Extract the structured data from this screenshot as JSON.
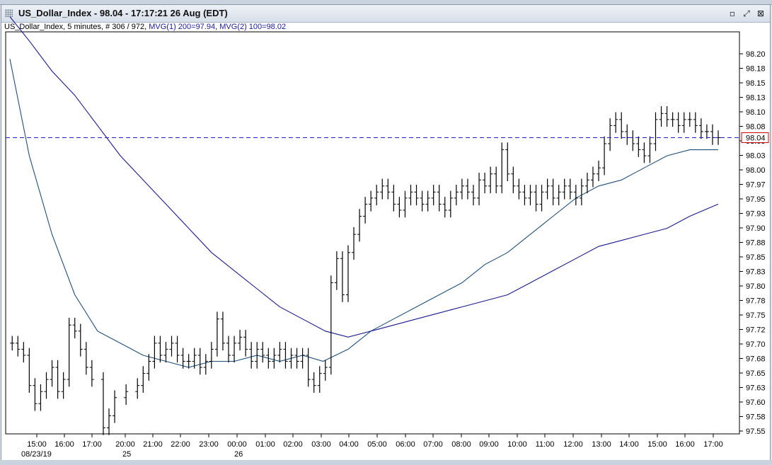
{
  "window": {
    "title": "US_Dollar_Index - 98.04 - 17:17:21  26 Aug (EDT)",
    "buttons": [
      "minimize-icon",
      "restore-icon",
      "close-icon"
    ]
  },
  "info": {
    "symbol": "US_Dollar_Index",
    "details": ", 5 minutes, # 306 / 972, ",
    "mvg1": "MVG(1) 200=97.94",
    "mvg2": "MVG(2) 100=98.02"
  },
  "colors": {
    "price": "#000000",
    "mvg1": "#1a1a8c",
    "mvg2": "#1f4f7a",
    "last_line": "#2222cc",
    "last_box": "#d40000"
  },
  "chart_data": {
    "type": "line",
    "title": "US_Dollar_Index",
    "interval": "5 minutes",
    "y_tick_labels": [
      "98.20",
      "98.18",
      "98.15",
      "98.13",
      "98.10",
      "98.08",
      "98.05",
      "98.03",
      "98.00",
      "97.97",
      "97.95",
      "97.93",
      "97.90",
      "97.88",
      "97.85",
      "97.83",
      "97.80",
      "97.78",
      "97.75",
      "97.72",
      "97.70",
      "97.68",
      "97.65",
      "97.63",
      "97.60",
      "97.58",
      "97.55"
    ],
    "ylim": [
      97.55,
      98.215
    ],
    "x_tick_labels": [
      "15:00",
      "16:00",
      "17:00",
      "20:00",
      "21:00",
      "22:00",
      "23:00",
      "00:00",
      "01:00",
      "02:00",
      "03:00",
      "04:00",
      "05:00",
      "06:00",
      "07:00",
      "08:00",
      "09:00",
      "10:00",
      "11:00",
      "12:00",
      "13:00",
      "14:00",
      "15:00",
      "16:00",
      "17:00"
    ],
    "date_labels": [
      {
        "text": "08/23/19",
        "at_tick": "15:00"
      },
      {
        "text": "25",
        "at_tick": "20:00"
      },
      {
        "text": "26",
        "at_tick": "00:00"
      }
    ],
    "last_value": 98.04,
    "last_value_label": "98.04",
    "price_path": [
      [
        14.25,
        97.7
      ],
      [
        14.5,
        97.69
      ],
      [
        14.75,
        97.68
      ],
      [
        15.0,
        97.63
      ],
      [
        15.25,
        97.6
      ],
      [
        15.5,
        97.62
      ],
      [
        15.75,
        97.64
      ],
      [
        16.0,
        97.66
      ],
      [
        16.25,
        97.62
      ],
      [
        16.5,
        97.64
      ],
      [
        16.75,
        97.73
      ],
      [
        17.0,
        97.72
      ],
      [
        17.25,
        97.69
      ],
      [
        17.5,
        97.66
      ],
      [
        17.75,
        97.64
      ],
      [
        18.25,
        97.56
      ],
      [
        18.5,
        97.58
      ],
      [
        18.75,
        97.61
      ],
      [
        19.25,
        97.62
      ],
      [
        19.75,
        97.63
      ],
      [
        20.0,
        97.65
      ],
      [
        20.25,
        97.67
      ],
      [
        20.5,
        97.7
      ],
      [
        20.75,
        97.68
      ],
      [
        21.0,
        97.69
      ],
      [
        21.25,
        97.7
      ],
      [
        21.5,
        97.68
      ],
      [
        21.75,
        97.67
      ],
      [
        22.0,
        97.67
      ],
      [
        22.25,
        97.68
      ],
      [
        22.5,
        97.66
      ],
      [
        22.75,
        97.67
      ],
      [
        23.0,
        97.69
      ],
      [
        23.25,
        97.74
      ],
      [
        23.5,
        97.7
      ],
      [
        23.75,
        97.68
      ],
      [
        24.0,
        97.7
      ],
      [
        24.25,
        97.71
      ],
      [
        24.5,
        97.69
      ],
      [
        24.75,
        97.67
      ],
      [
        25.0,
        97.69
      ],
      [
        25.25,
        97.68
      ],
      [
        25.5,
        97.67
      ],
      [
        25.75,
        97.68
      ],
      [
        26.0,
        97.69
      ],
      [
        26.25,
        97.67
      ],
      [
        26.5,
        97.68
      ],
      [
        26.75,
        97.67
      ],
      [
        27.0,
        97.68
      ],
      [
        27.25,
        97.64
      ],
      [
        27.5,
        97.63
      ],
      [
        27.75,
        97.65
      ],
      [
        28.0,
        97.66
      ],
      [
        28.25,
        97.8
      ],
      [
        28.5,
        97.84
      ],
      [
        28.75,
        97.78
      ],
      [
        29.0,
        97.85
      ],
      [
        29.25,
        97.88
      ],
      [
        29.5,
        97.91
      ],
      [
        29.75,
        97.93
      ],
      [
        30.0,
        97.94
      ],
      [
        30.25,
        97.95
      ],
      [
        30.5,
        97.96
      ],
      [
        30.75,
        97.95
      ],
      [
        31.0,
        97.93
      ],
      [
        31.25,
        97.92
      ],
      [
        31.5,
        97.94
      ],
      [
        31.75,
        97.95
      ],
      [
        32.0,
        97.94
      ],
      [
        32.25,
        97.93
      ],
      [
        32.5,
        97.94
      ],
      [
        32.75,
        97.95
      ],
      [
        33.0,
        97.93
      ],
      [
        33.25,
        97.92
      ],
      [
        33.5,
        97.94
      ],
      [
        33.75,
        97.95
      ],
      [
        34.0,
        97.96
      ],
      [
        34.25,
        97.95
      ],
      [
        34.5,
        97.94
      ],
      [
        34.75,
        97.97
      ],
      [
        35.0,
        97.96
      ],
      [
        35.25,
        97.98
      ],
      [
        35.5,
        97.96
      ],
      [
        35.75,
        98.02
      ],
      [
        36.0,
        97.98
      ],
      [
        36.25,
        97.96
      ],
      [
        36.5,
        97.95
      ],
      [
        36.75,
        97.94
      ],
      [
        37.0,
        97.95
      ],
      [
        37.25,
        97.93
      ],
      [
        37.5,
        97.95
      ],
      [
        37.75,
        97.96
      ],
      [
        38.0,
        97.94
      ],
      [
        38.25,
        97.95
      ],
      [
        38.5,
        97.96
      ],
      [
        38.75,
        97.95
      ],
      [
        39.0,
        97.94
      ],
      [
        39.25,
        97.96
      ],
      [
        39.5,
        97.97
      ],
      [
        39.75,
        97.98
      ],
      [
        40.0,
        97.99
      ],
      [
        40.25,
        98.03
      ],
      [
        40.5,
        98.06
      ],
      [
        40.75,
        98.07
      ],
      [
        41.0,
        98.05
      ],
      [
        41.25,
        98.04
      ],
      [
        41.5,
        98.03
      ],
      [
        41.75,
        98.02
      ],
      [
        42.0,
        98.01
      ],
      [
        42.25,
        98.03
      ],
      [
        42.5,
        98.07
      ],
      [
        42.75,
        98.08
      ],
      [
        43.0,
        98.07
      ],
      [
        43.25,
        98.07
      ],
      [
        43.5,
        98.06
      ],
      [
        43.75,
        98.07
      ],
      [
        44.0,
        98.07
      ],
      [
        44.25,
        98.06
      ],
      [
        44.5,
        98.05
      ],
      [
        44.75,
        98.05
      ],
      [
        45.0,
        98.04
      ],
      [
        45.25,
        98.04
      ]
    ],
    "series": [
      {
        "name": "MVG(1) 200",
        "value_label": "97.94",
        "points": [
          [
            14.15,
            98.17
          ],
          [
            15.0,
            98.01
          ],
          [
            16.0,
            97.88
          ],
          [
            17.0,
            97.78
          ],
          [
            18.0,
            97.72
          ],
          [
            19.0,
            97.7
          ],
          [
            20.0,
            97.68
          ],
          [
            21.0,
            97.67
          ],
          [
            22.0,
            97.66
          ],
          [
            23.0,
            97.67
          ],
          [
            24.0,
            97.67
          ],
          [
            25.0,
            97.68
          ],
          [
            26.0,
            97.67
          ],
          [
            27.0,
            97.68
          ],
          [
            27.9,
            97.67
          ],
          [
            29.0,
            97.69
          ],
          [
            30.0,
            97.72
          ],
          [
            31.0,
            97.74
          ],
          [
            32.0,
            97.76
          ],
          [
            33.0,
            97.78
          ],
          [
            34.0,
            97.8
          ],
          [
            35.0,
            97.83
          ],
          [
            36.0,
            97.85
          ],
          [
            37.0,
            97.88
          ],
          [
            38.0,
            97.91
          ],
          [
            39.0,
            97.94
          ],
          [
            40.0,
            97.96
          ],
          [
            41.0,
            97.97
          ],
          [
            42.0,
            97.99
          ],
          [
            43.0,
            98.01
          ],
          [
            44.0,
            98.02
          ],
          [
            45.25,
            98.02
          ]
        ]
      },
      {
        "name": "MVG(2) 100",
        "value_label": "98.02",
        "points": [
          [
            14.15,
            98.24
          ],
          [
            15.0,
            98.2
          ],
          [
            16.0,
            98.15
          ],
          [
            17.0,
            98.11
          ],
          [
            18.0,
            98.06
          ],
          [
            19.0,
            98.01
          ],
          [
            20.0,
            97.97
          ],
          [
            21.0,
            97.93
          ],
          [
            22.0,
            97.89
          ],
          [
            23.0,
            97.85
          ],
          [
            24.0,
            97.82
          ],
          [
            25.0,
            97.79
          ],
          [
            26.0,
            97.76
          ],
          [
            27.0,
            97.74
          ],
          [
            28.0,
            97.72
          ],
          [
            29.0,
            97.71
          ],
          [
            30.0,
            97.72
          ],
          [
            31.0,
            97.73
          ],
          [
            32.0,
            97.74
          ],
          [
            33.0,
            97.75
          ],
          [
            34.0,
            97.76
          ],
          [
            35.0,
            97.77
          ],
          [
            36.0,
            97.78
          ],
          [
            37.0,
            97.8
          ],
          [
            38.0,
            97.82
          ],
          [
            39.0,
            97.84
          ],
          [
            40.0,
            97.86
          ],
          [
            41.0,
            97.87
          ],
          [
            42.0,
            97.88
          ],
          [
            43.0,
            97.89
          ],
          [
            44.0,
            97.91
          ],
          [
            45.25,
            97.93
          ]
        ]
      }
    ],
    "grid": false,
    "legend": "none"
  }
}
